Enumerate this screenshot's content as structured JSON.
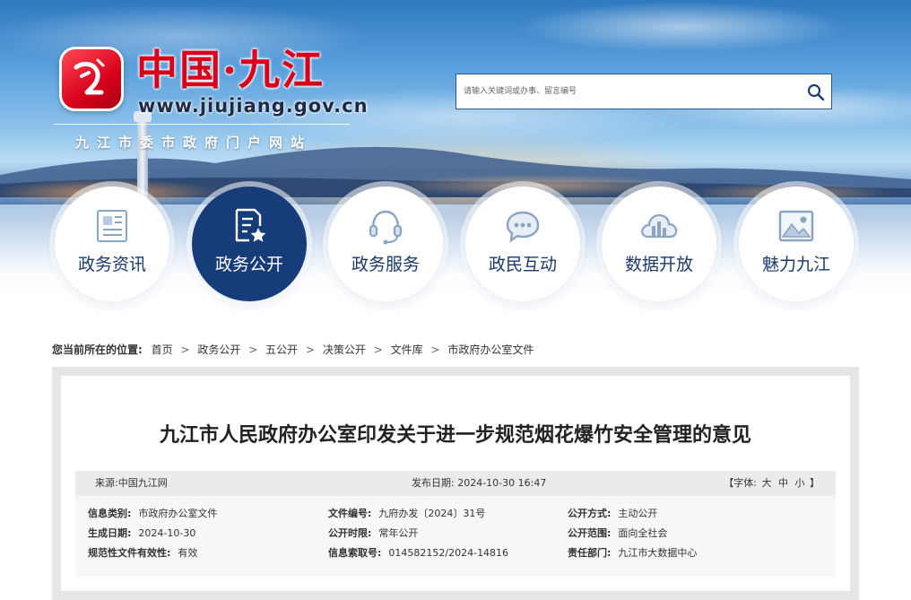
{
  "site": {
    "title": "中国·九江",
    "url": "www.jiujiang.gov.cn",
    "subtitle": "九江市委市政府门户网站",
    "brand_red": "#d9001b",
    "brand_navy": "#163d7a"
  },
  "search": {
    "placeholder": "请输入关键词或办事、留言编号",
    "icon": "search-icon"
  },
  "nav": [
    {
      "label": "政务资讯",
      "icon": "news-icon",
      "active": false
    },
    {
      "label": "政务公开",
      "icon": "document-star-icon",
      "active": true
    },
    {
      "label": "政务服务",
      "icon": "headset-icon",
      "active": false
    },
    {
      "label": "政民互动",
      "icon": "chat-icon",
      "active": false
    },
    {
      "label": "数据开放",
      "icon": "data-cloud-icon",
      "active": false
    },
    {
      "label": "魅力九江",
      "icon": "image-icon",
      "active": false
    }
  ],
  "breadcrumb": {
    "lead": "您当前所在的位置:",
    "items": [
      "首页",
      "政务公开",
      "五公开",
      "决策公开",
      "文件库",
      "市政府办公室文件"
    ]
  },
  "article": {
    "title": "九江市人民政府办公室印发关于进一步规范烟花爆竹安全管理的意见",
    "source": "来源:中国九江网",
    "publish_date": "发布日期: 2024-10-30 16:47",
    "font_label": "【字体:",
    "font_large": "大",
    "font_medium": "中",
    "font_small": "小",
    "font_close": "】",
    "info": {
      "category_label": "信息类别:",
      "category": "市政府办公室文件",
      "doc_no_label": "文件编号:",
      "doc_no": "九府办发〔2024〕31号",
      "open_method_label": "公开方式:",
      "open_method": "主动公开",
      "created_label": "生成日期:",
      "created": "2024-10-30",
      "open_period_label": "公开时限:",
      "open_period": "常年公开",
      "open_scope_label": "公开范围:",
      "open_scope": "面向全社会",
      "validity_label": "规范性文件有效性:",
      "validity": "有效",
      "index_no_label": "信息索取号:",
      "index_no": "014582152/2024-14816",
      "dept_label": "责任部门:",
      "dept": "九江市大数据中心"
    }
  }
}
